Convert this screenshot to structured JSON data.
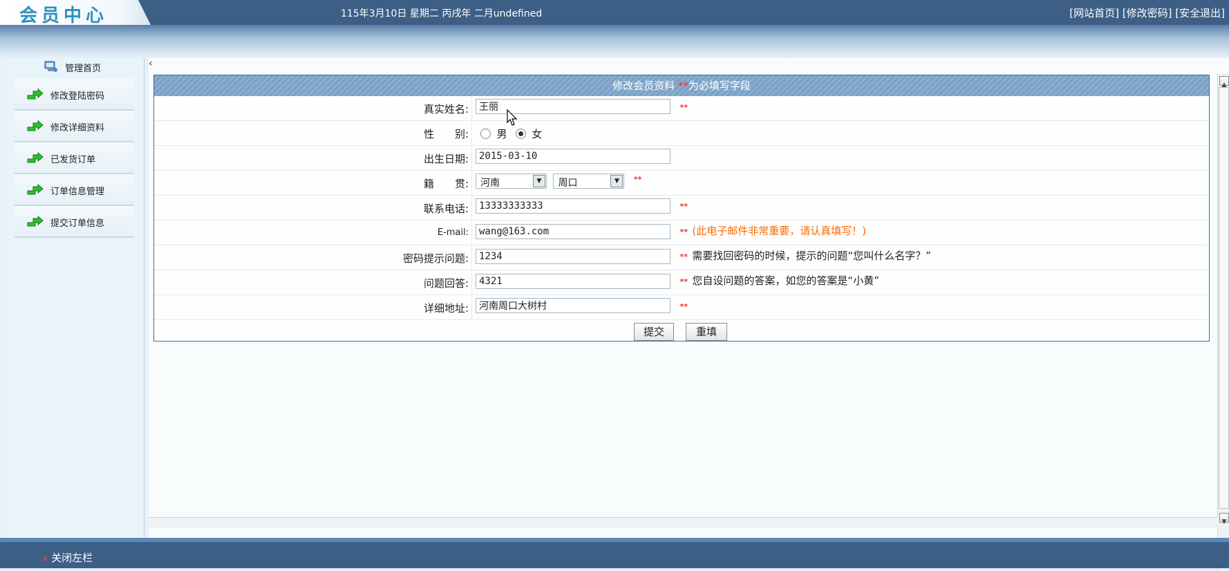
{
  "header": {
    "logo": "会员中心",
    "date": "115年3月10日 星期二 丙戌年 二月undefined",
    "links": [
      "[网站首页]",
      "[修改密码]",
      "[安全退出]"
    ]
  },
  "sidebar": {
    "home_label": "管理首页",
    "items": [
      {
        "label": "修改登陆密码"
      },
      {
        "label": "修改详细资料"
      },
      {
        "label": "已发货订单"
      },
      {
        "label": "订单信息管理"
      },
      {
        "label": "提交订单信息"
      }
    ]
  },
  "main": {
    "collapse_glyph": "‹"
  },
  "form": {
    "title": "修改会员资料",
    "required_mark": "**",
    "required_text": "为必填写字段",
    "name_label": "真实姓名:",
    "name_value": "王丽",
    "gender_label": "性　　别:",
    "gender_options": [
      "男",
      "女"
    ],
    "gender_selected": "女",
    "birth_label": "出生日期:",
    "birth_value": "2015-03-10",
    "origin_label": "籍　　贯:",
    "province_value": "河南",
    "city_value": "周口",
    "phone_label": "联系电话:",
    "phone_value": "13333333333",
    "email_label": "E-mail:",
    "email_value": "wang@163.com",
    "email_hint": "(此电子邮件非常重要，请认真填写！)",
    "question_label": "密码提示问题:",
    "question_value": "1234",
    "question_hint": "需要找回密码的时候，提示的问题“您叫什么名字？”",
    "answer_label": "问题回答:",
    "answer_value": "4321",
    "answer_hint": "您自设问题的答案，如您的答案是“小黄”",
    "address_label": "详细地址:",
    "address_value": "河南周口大树村",
    "submit_label": "提交",
    "reset_label": "重填"
  },
  "footer": {
    "close_label": "关闭左栏",
    "close_mark": "×"
  },
  "colors": {
    "topbar": "#3d5f86",
    "header_stripe": "#7aa0c4",
    "required": "#ff2b2b",
    "hint": "#ff6a00"
  }
}
